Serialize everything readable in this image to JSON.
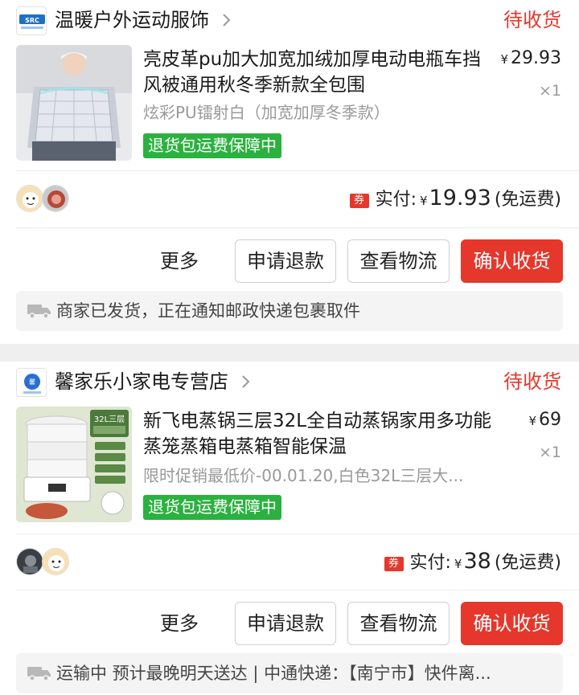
{
  "orders": [
    {
      "shop_name": "温暖户外运动服饰",
      "shop_logo_icon": "shop-logo-icon",
      "status": "待收货",
      "product_title": "亮皮革pu加大加宽加绒加厚电动电瓶车挡风被通用秋冬季新款全包围",
      "price_symbol": "¥",
      "price": "29.93",
      "quantity": "×1",
      "spec": "炫彩PU镭射白（加宽加厚冬季款）",
      "guarantee": "退货包运费保障中",
      "coupon_label": "券",
      "paid_label": "实付:",
      "paid_symbol": "¥",
      "paid_amount": "19.93",
      "shipping_note": "(免运费)",
      "buttons": {
        "more": "更多",
        "refund": "申请退款",
        "logistics": "查看物流",
        "confirm": "确认收货"
      },
      "logistics_info": "商家已发货，正在通知邮政快递包裹取件"
    },
    {
      "shop_name": "馨家乐小家电专营店",
      "shop_logo_icon": "shop-logo-icon",
      "status": "待收货",
      "product_title": "新飞电蒸锅三层32L全自动蒸锅家用多功能蒸笼蒸箱电蒸箱智能保温",
      "price_symbol": "¥",
      "price": "69",
      "quantity": "×1",
      "spec": "限时促销最低价-00.01.20,白色32L三层大...",
      "guarantee": "退货包运费保障中",
      "thumb_badge": "32L三层",
      "coupon_label": "券",
      "paid_label": "实付:",
      "paid_symbol": "¥",
      "paid_amount": "38",
      "shipping_note": "(免运费)",
      "buttons": {
        "more": "更多",
        "refund": "申请退款",
        "logistics": "查看物流",
        "confirm": "确认收货"
      },
      "logistics_info": "运输中 预计最晚明天送达 | 中通快递：【南宁市】快件离..."
    }
  ],
  "colors": {
    "accent": "#e5372b",
    "guarantee": "#2bb140",
    "muted": "#999999"
  }
}
